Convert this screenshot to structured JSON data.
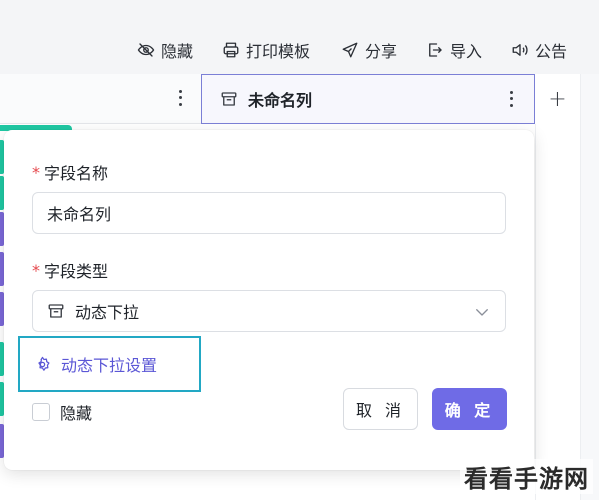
{
  "toolbar": {
    "hide": {
      "label": "隐藏",
      "icon": "eye-off-icon"
    },
    "print_template": {
      "label": "打印模板",
      "icon": "printer-icon"
    },
    "share": {
      "label": "分享",
      "icon": "paper-plane-icon"
    },
    "import": {
      "label": "导入",
      "icon": "import-icon"
    },
    "announcement": {
      "label": "公告",
      "icon": "speaker-icon"
    }
  },
  "table": {
    "active_column": {
      "title": "未命名列",
      "icon": "dropdown-field-icon"
    },
    "add_column_label": "+"
  },
  "panel": {
    "name_field": {
      "label": "字段名称",
      "required_mark": "*",
      "value": "未命名列"
    },
    "type_field": {
      "label": "字段类型",
      "required_mark": "*",
      "value": "动态下拉",
      "icon": "dropdown-field-icon"
    },
    "settings_link": {
      "label": "动态下拉设置",
      "icon": "gear-icon"
    },
    "hide_checkbox": {
      "label": "隐藏",
      "checked": false
    },
    "cancel_label": "取 消",
    "confirm_label": "确 定"
  },
  "colors": {
    "accent": "#6f6be6",
    "link": "#5b57d6",
    "highlight_border": "#22a8c4",
    "teal_marker": "#1fc8a3",
    "purple_marker": "#7b68d8",
    "required": "#e5484d"
  },
  "watermark": "看看手游网"
}
